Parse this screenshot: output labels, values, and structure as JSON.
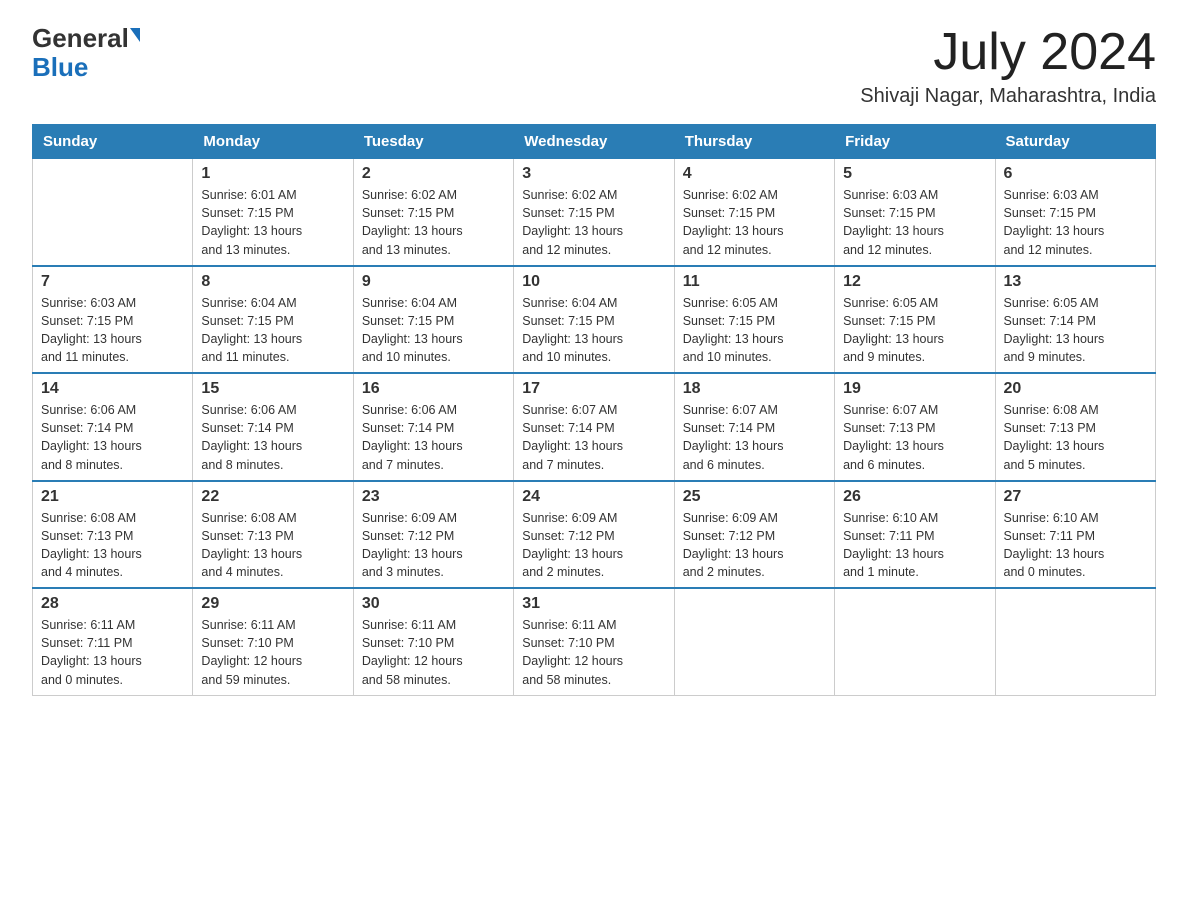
{
  "header": {
    "logo_general": "General",
    "logo_blue": "Blue",
    "month_year": "July 2024",
    "location": "Shivaji Nagar, Maharashtra, India"
  },
  "weekdays": [
    "Sunday",
    "Monday",
    "Tuesday",
    "Wednesday",
    "Thursday",
    "Friday",
    "Saturday"
  ],
  "weeks": [
    [
      {
        "day": "",
        "info": ""
      },
      {
        "day": "1",
        "info": "Sunrise: 6:01 AM\nSunset: 7:15 PM\nDaylight: 13 hours\nand 13 minutes."
      },
      {
        "day": "2",
        "info": "Sunrise: 6:02 AM\nSunset: 7:15 PM\nDaylight: 13 hours\nand 13 minutes."
      },
      {
        "day": "3",
        "info": "Sunrise: 6:02 AM\nSunset: 7:15 PM\nDaylight: 13 hours\nand 12 minutes."
      },
      {
        "day": "4",
        "info": "Sunrise: 6:02 AM\nSunset: 7:15 PM\nDaylight: 13 hours\nand 12 minutes."
      },
      {
        "day": "5",
        "info": "Sunrise: 6:03 AM\nSunset: 7:15 PM\nDaylight: 13 hours\nand 12 minutes."
      },
      {
        "day": "6",
        "info": "Sunrise: 6:03 AM\nSunset: 7:15 PM\nDaylight: 13 hours\nand 12 minutes."
      }
    ],
    [
      {
        "day": "7",
        "info": "Sunrise: 6:03 AM\nSunset: 7:15 PM\nDaylight: 13 hours\nand 11 minutes."
      },
      {
        "day": "8",
        "info": "Sunrise: 6:04 AM\nSunset: 7:15 PM\nDaylight: 13 hours\nand 11 minutes."
      },
      {
        "day": "9",
        "info": "Sunrise: 6:04 AM\nSunset: 7:15 PM\nDaylight: 13 hours\nand 10 minutes."
      },
      {
        "day": "10",
        "info": "Sunrise: 6:04 AM\nSunset: 7:15 PM\nDaylight: 13 hours\nand 10 minutes."
      },
      {
        "day": "11",
        "info": "Sunrise: 6:05 AM\nSunset: 7:15 PM\nDaylight: 13 hours\nand 10 minutes."
      },
      {
        "day": "12",
        "info": "Sunrise: 6:05 AM\nSunset: 7:15 PM\nDaylight: 13 hours\nand 9 minutes."
      },
      {
        "day": "13",
        "info": "Sunrise: 6:05 AM\nSunset: 7:14 PM\nDaylight: 13 hours\nand 9 minutes."
      }
    ],
    [
      {
        "day": "14",
        "info": "Sunrise: 6:06 AM\nSunset: 7:14 PM\nDaylight: 13 hours\nand 8 minutes."
      },
      {
        "day": "15",
        "info": "Sunrise: 6:06 AM\nSunset: 7:14 PM\nDaylight: 13 hours\nand 8 minutes."
      },
      {
        "day": "16",
        "info": "Sunrise: 6:06 AM\nSunset: 7:14 PM\nDaylight: 13 hours\nand 7 minutes."
      },
      {
        "day": "17",
        "info": "Sunrise: 6:07 AM\nSunset: 7:14 PM\nDaylight: 13 hours\nand 7 minutes."
      },
      {
        "day": "18",
        "info": "Sunrise: 6:07 AM\nSunset: 7:14 PM\nDaylight: 13 hours\nand 6 minutes."
      },
      {
        "day": "19",
        "info": "Sunrise: 6:07 AM\nSunset: 7:13 PM\nDaylight: 13 hours\nand 6 minutes."
      },
      {
        "day": "20",
        "info": "Sunrise: 6:08 AM\nSunset: 7:13 PM\nDaylight: 13 hours\nand 5 minutes."
      }
    ],
    [
      {
        "day": "21",
        "info": "Sunrise: 6:08 AM\nSunset: 7:13 PM\nDaylight: 13 hours\nand 4 minutes."
      },
      {
        "day": "22",
        "info": "Sunrise: 6:08 AM\nSunset: 7:13 PM\nDaylight: 13 hours\nand 4 minutes."
      },
      {
        "day": "23",
        "info": "Sunrise: 6:09 AM\nSunset: 7:12 PM\nDaylight: 13 hours\nand 3 minutes."
      },
      {
        "day": "24",
        "info": "Sunrise: 6:09 AM\nSunset: 7:12 PM\nDaylight: 13 hours\nand 2 minutes."
      },
      {
        "day": "25",
        "info": "Sunrise: 6:09 AM\nSunset: 7:12 PM\nDaylight: 13 hours\nand 2 minutes."
      },
      {
        "day": "26",
        "info": "Sunrise: 6:10 AM\nSunset: 7:11 PM\nDaylight: 13 hours\nand 1 minute."
      },
      {
        "day": "27",
        "info": "Sunrise: 6:10 AM\nSunset: 7:11 PM\nDaylight: 13 hours\nand 0 minutes."
      }
    ],
    [
      {
        "day": "28",
        "info": "Sunrise: 6:11 AM\nSunset: 7:11 PM\nDaylight: 13 hours\nand 0 minutes."
      },
      {
        "day": "29",
        "info": "Sunrise: 6:11 AM\nSunset: 7:10 PM\nDaylight: 12 hours\nand 59 minutes."
      },
      {
        "day": "30",
        "info": "Sunrise: 6:11 AM\nSunset: 7:10 PM\nDaylight: 12 hours\nand 58 minutes."
      },
      {
        "day": "31",
        "info": "Sunrise: 6:11 AM\nSunset: 7:10 PM\nDaylight: 12 hours\nand 58 minutes."
      },
      {
        "day": "",
        "info": ""
      },
      {
        "day": "",
        "info": ""
      },
      {
        "day": "",
        "info": ""
      }
    ]
  ]
}
